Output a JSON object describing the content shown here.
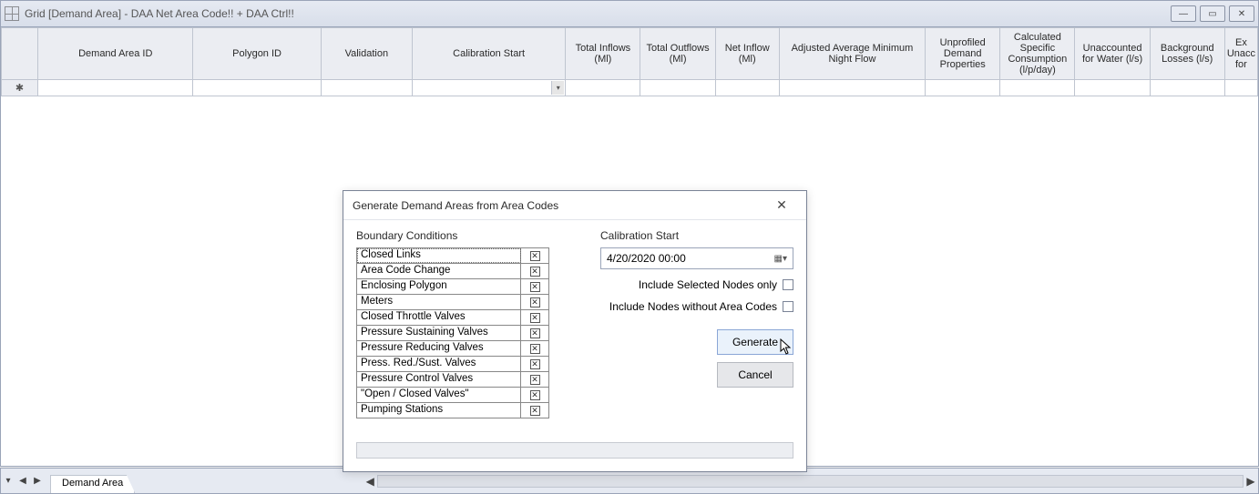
{
  "window": {
    "title": "Grid [Demand Area] - DAA Net Area Code!! + DAA Ctrl!!"
  },
  "columns": [
    "Demand Area ID",
    "Polygon ID",
    "Validation",
    "Calibration Start",
    "Total Inflows (Ml)",
    "Total Outflows (Ml)",
    "Net Inflow (Ml)",
    "Adjusted Average Minimum Night Flow",
    "Unprofiled Demand Properties",
    "Calculated Specific Consumption (l/p/day)",
    "Unaccounted for Water (l/s)",
    "Background Losses (l/s)",
    "Ex Unacc for"
  ],
  "row_marker": "✱",
  "tab": {
    "label": "Demand Area"
  },
  "dialog": {
    "title": "Generate Demand Areas from Area Codes",
    "boundary_label": "Boundary Conditions",
    "boundary_items": [
      "Closed Links",
      "Area Code Change",
      "Enclosing Polygon",
      "Meters",
      "Closed Throttle Valves",
      "Pressure Sustaining Valves",
      "Pressure Reducing Valves",
      "Press. Red./Sust. Valves",
      "Pressure Control Valves",
      "\"Open / Closed Valves\"",
      "Pumping Stations"
    ],
    "calibration_label": "Calibration Start",
    "calibration_value": "4/20/2020 00:00",
    "opt_selected_only": "Include Selected Nodes only",
    "opt_no_area_codes": "Include Nodes without Area Codes",
    "generate": "Generate",
    "cancel": "Cancel"
  }
}
